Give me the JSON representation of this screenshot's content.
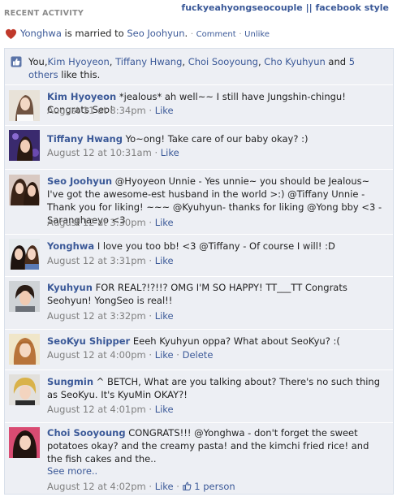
{
  "header": {
    "section_title": "RECENT ACTIVITY",
    "brand": "fuckyeahyongseocouple || facebook style"
  },
  "story": {
    "actor": "Yonghwa",
    "verb": " is married to ",
    "partner": "Seo Joohyun",
    "after_partner": ".",
    "comment_label": "Comment",
    "unlike_label": "Unlike"
  },
  "likes": {
    "prefix": "You,",
    "names": [
      "Kim Hyoyeon",
      "Tiffany Hwang",
      "Choi Sooyoung",
      "Cho Kyuhyun"
    ],
    "and": " and ",
    "others": "5 others",
    "suffix": " like this."
  },
  "comments": [
    {
      "author": "Kim Hyoyeon",
      "text": " *jealous* ah well~~ I still have Jungshin-chingu! Congrats Seo!",
      "time": "August 11 at 8:34pm",
      "actions": [
        "Like"
      ]
    },
    {
      "author": "Tiffany Hwang",
      "text": " Yo~ong! Take care of our baby okay? :)",
      "time": "August 12 at 10:31am",
      "actions": [
        "Like"
      ]
    },
    {
      "author": "Seo Joohyun",
      "text": " @Hyoyeon Unnie - Yes unnie~ you should be Jealous~ I've got the awesome-est husband in the world >:) @Tiffany Unnie - Thank you for liking! ~~~ @Kyuhyun- thanks for liking @Yong bby <3 - Saranghaeyo <3",
      "time": "August 12 at 3:30pm",
      "actions": [
        "Like"
      ]
    },
    {
      "author": "Yonghwa",
      "text": " I love you too bb! <3 @Tiffany - Of course I will! :D",
      "time": "August 12 at 3:31pm",
      "actions": [
        "Like"
      ]
    },
    {
      "author": "Kyuhyun",
      "text": " FOR REAL?!?!!? OMG I'M SO HAPPY! TT___TT Congrats Seohyun! YongSeo is real!!",
      "time": "August 12 at 3:32pm",
      "actions": [
        "Like"
      ]
    },
    {
      "author": "SeoKyu Shipper",
      "text": " Eeeh Kyuhyun oppa? What about SeoKyu? :(",
      "time": "August 12 at 4:00pm",
      "actions": [
        "Like",
        "Delete"
      ]
    },
    {
      "author": "Sungmin",
      "text": " ^ BETCH, What are you talking about? There's no such thing as SeoKyu. It's KyuMin OKAY?!",
      "time": "August 12 at 4:01pm",
      "actions": [
        "Like"
      ]
    },
    {
      "author": "Choi Sooyoung",
      "text": " CONGRATS!!! @Yonghwa - don't forget the sweet potatoes okay? and the creamy pasta! and the kimchi fried rice! and the fish cakes and the..",
      "see_more": "See more..",
      "time": "August 12 at 4:02pm",
      "actions": [
        "Like"
      ],
      "like_count": "1 person"
    }
  ],
  "colors": {
    "link": "#3b5998",
    "feed_bg": "#edeff4",
    "meta": "#808080",
    "heart": "#c0392b"
  }
}
